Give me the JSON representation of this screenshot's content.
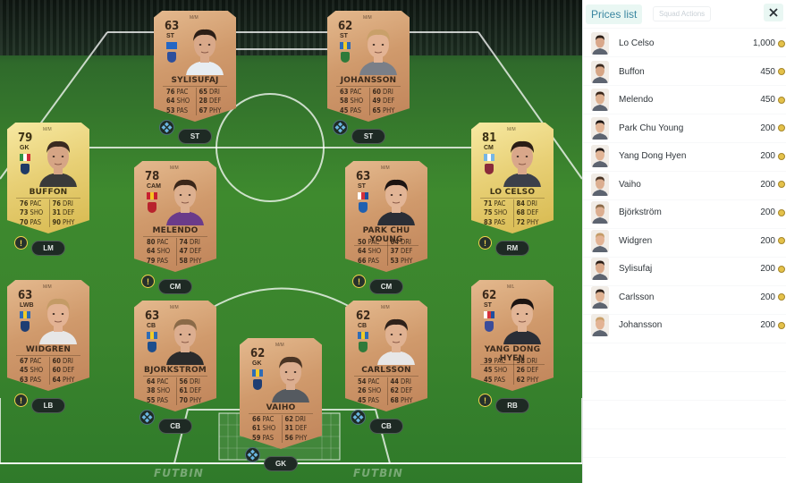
{
  "pitch": {
    "watermarks": [
      "FUTBIN",
      "FUTBIN"
    ],
    "cards": [
      {
        "id": "sylisufaj",
        "tier": "bronze",
        "rating": "63",
        "position": "ST",
        "chem": "M/M",
        "name": "SYLISUFAJ",
        "flag": [
          "#2466c4",
          "#2466c4",
          "#2466c4"
        ],
        "club": "#2d4f9c",
        "skin": "#d9a98a",
        "hair": "#2b1e16",
        "shirt": "#e7edf2",
        "stats": [
          [
            "76",
            "PAC"
          ],
          [
            "64",
            "SHO"
          ],
          [
            "53",
            "PAS"
          ],
          [
            "65",
            "DRI"
          ],
          [
            "28",
            "DEF"
          ],
          [
            "67",
            "PHY"
          ]
        ],
        "badge": "ST",
        "badge_type": "chem"
      },
      {
        "id": "johansson",
        "tier": "bronze",
        "rating": "62",
        "position": "ST",
        "chem": "M/M",
        "name": "JOHANSSON",
        "flag": [
          "#2f6cb6",
          "#f1cc29",
          "#2f6cb6"
        ],
        "club": "#2f7a3a",
        "skin": "#e3b394",
        "hair": "#c9a06a",
        "shirt": "#7a7f88",
        "stats": [
          [
            "63",
            "PAC"
          ],
          [
            "58",
            "SHO"
          ],
          [
            "45",
            "PAS"
          ],
          [
            "60",
            "DRI"
          ],
          [
            "49",
            "DEF"
          ],
          [
            "65",
            "PHY"
          ]
        ],
        "badge": "ST",
        "badge_type": "chem"
      },
      {
        "id": "buffon",
        "tier": "gold",
        "rating": "79",
        "position": "GK",
        "chem": "M/M",
        "name": "BUFFON",
        "flag": [
          "#2f9345",
          "#ffffff",
          "#cf2b37"
        ],
        "club": "#1f3a66",
        "skin": "#d6a585",
        "hair": "#3a2a20",
        "shirt": "#3a3a3a",
        "stats": [
          [
            "76",
            "PAC"
          ],
          [
            "73",
            "SHO"
          ],
          [
            "70",
            "PAS"
          ],
          [
            "76",
            "DRI"
          ],
          [
            "31",
            "DEF"
          ],
          [
            "90",
            "PHY"
          ]
        ],
        "badge": "LM",
        "badge_type": "alert"
      },
      {
        "id": "melendo",
        "tier": "bronze",
        "rating": "78",
        "position": "CAM",
        "chem": "M/M",
        "name": "MELENDO",
        "flag": [
          "#c8202f",
          "#f6c324",
          "#c8202f"
        ],
        "club": "#b8232d",
        "skin": "#ddb090",
        "hair": "#3a2619",
        "shirt": "#6a3b8a",
        "stats": [
          [
            "80",
            "PAC"
          ],
          [
            "64",
            "SHO"
          ],
          [
            "79",
            "PAS"
          ],
          [
            "74",
            "DRI"
          ],
          [
            "47",
            "DEF"
          ],
          [
            "58",
            "PHY"
          ]
        ],
        "badge": "CM",
        "badge_type": "alert"
      },
      {
        "id": "parkchuyoung",
        "tier": "bronze",
        "rating": "63",
        "position": "ST",
        "chem": "M/M",
        "name": "PARK CHU YOUNG",
        "flag": [
          "#ffffff",
          "#d6313b",
          "#1d4fa0"
        ],
        "club": "#1f60b0",
        "skin": "#e2b596",
        "hair": "#1c1412",
        "shirt": "#2a2e36",
        "stats": [
          [
            "50",
            "PAC"
          ],
          [
            "64",
            "SHO"
          ],
          [
            "66",
            "PAS"
          ],
          [
            "64",
            "DRI"
          ],
          [
            "37",
            "DEF"
          ],
          [
            "53",
            "PHY"
          ]
        ],
        "badge": "CM",
        "badge_type": "alert"
      },
      {
        "id": "locelso",
        "tier": "gold",
        "rating": "81",
        "position": "CM",
        "chem": "M/M",
        "name": "LO CELSO",
        "flag": [
          "#76b6e4",
          "#ffffff",
          "#76b6e4"
        ],
        "club": "#8a2a3a",
        "skin": "#d9a78a",
        "hair": "#2a1d15",
        "shirt": "#3b3f4a",
        "stats": [
          [
            "71",
            "PAC"
          ],
          [
            "75",
            "SHO"
          ],
          [
            "83",
            "PAS"
          ],
          [
            "84",
            "DRI"
          ],
          [
            "68",
            "DEF"
          ],
          [
            "72",
            "PHY"
          ]
        ],
        "badge": "RM",
        "badge_type": "alert"
      },
      {
        "id": "widgren",
        "tier": "bronze",
        "rating": "63",
        "position": "LWB",
        "chem": "M/M",
        "name": "WIDGREN",
        "flag": [
          "#2f6cb6",
          "#f1cc29",
          "#2f6cb6"
        ],
        "club": "#1f3e73",
        "skin": "#e3b394",
        "hair": "#c49b66",
        "shirt": "#e7e7e7",
        "stats": [
          [
            "67",
            "PAC"
          ],
          [
            "45",
            "SHO"
          ],
          [
            "63",
            "PAS"
          ],
          [
            "60",
            "DRI"
          ],
          [
            "60",
            "DEF"
          ],
          [
            "64",
            "PHY"
          ]
        ],
        "badge": "LB",
        "badge_type": "alert"
      },
      {
        "id": "bjorkstrom",
        "tier": "bronze",
        "rating": "63",
        "position": "CB",
        "chem": "M/M",
        "name": "BJORKSTROM",
        "flag": [
          "#2f6cb6",
          "#f1cc29",
          "#2f6cb6"
        ],
        "club": "#1c4d8c",
        "skin": "#dcae90",
        "hair": "#8a6a48",
        "shirt": "#2b2b2b",
        "stats": [
          [
            "64",
            "PAC"
          ],
          [
            "38",
            "SHO"
          ],
          [
            "55",
            "PAS"
          ],
          [
            "56",
            "DRI"
          ],
          [
            "61",
            "DEF"
          ],
          [
            "70",
            "PHY"
          ]
        ],
        "badge": "CB",
        "badge_type": "chem"
      },
      {
        "id": "vaiho",
        "tier": "bronze",
        "rating": "62",
        "position": "GK",
        "chem": "M/M",
        "name": "VAIHO",
        "flag": [
          "#2f6cb6",
          "#f1cc29",
          "#2f6cb6"
        ],
        "club": "#1f3e73",
        "skin": "#dcae90",
        "hair": "#4a3424",
        "shirt": "#555a60",
        "stats": [
          [
            "66",
            "PAC"
          ],
          [
            "61",
            "SHO"
          ],
          [
            "59",
            "PAS"
          ],
          [
            "62",
            "DRI"
          ],
          [
            "31",
            "DEF"
          ],
          [
            "56",
            "PHY"
          ]
        ],
        "badge": "GK",
        "badge_type": "chem"
      },
      {
        "id": "carlsson",
        "tier": "bronze",
        "rating": "62",
        "position": "CB",
        "chem": "M/M",
        "name": "CARLSSON",
        "flag": [
          "#2f6cb6",
          "#f1cc29",
          "#2f6cb6"
        ],
        "club": "#2f7a3a",
        "skin": "#e0b292",
        "hair": "#2e211a",
        "shirt": "#e7e7e7",
        "stats": [
          [
            "54",
            "PAC"
          ],
          [
            "26",
            "SHO"
          ],
          [
            "45",
            "PAS"
          ],
          [
            "44",
            "DRI"
          ],
          [
            "62",
            "DEF"
          ],
          [
            "68",
            "PHY"
          ]
        ],
        "badge": "CB",
        "badge_type": "chem"
      },
      {
        "id": "yangdonghyen",
        "tier": "bronze",
        "rating": "62",
        "position": "ST",
        "chem": "M/L",
        "name": "YANG DONG HYEN",
        "flag": [
          "#ffffff",
          "#d6313b",
          "#1d4fa0"
        ],
        "club": "#3a4c9a",
        "skin": "#e2b596",
        "hair": "#1c1412",
        "shirt": "#2a2e36",
        "stats": [
          [
            "39",
            "PAC"
          ],
          [
            "45",
            "SHO"
          ],
          [
            "45",
            "PAS"
          ],
          [
            "58",
            "DRI"
          ],
          [
            "26",
            "DEF"
          ],
          [
            "62",
            "PHY"
          ]
        ],
        "badge": "RB",
        "badge_type": "alert"
      }
    ]
  },
  "panel": {
    "title": "Prices list",
    "ghost_tab": "Squad Actions",
    "close_label": "close",
    "items": [
      {
        "name": "Lo Celso",
        "price": "1,000",
        "skin": "#d9a78a",
        "hair": "#2a1d15"
      },
      {
        "name": "Buffon",
        "price": "450",
        "skin": "#d6a585",
        "hair": "#3a2a20"
      },
      {
        "name": "Melendo",
        "price": "450",
        "skin": "#ddb090",
        "hair": "#3a2619"
      },
      {
        "name": "Park Chu Young",
        "price": "200",
        "skin": "#e2b596",
        "hair": "#1c1412"
      },
      {
        "name": "Yang Dong Hyen",
        "price": "200",
        "skin": "#e2b596",
        "hair": "#1c1412"
      },
      {
        "name": "Vaiho",
        "price": "200",
        "skin": "#dcae90",
        "hair": "#4a3424"
      },
      {
        "name": "Björkström",
        "price": "200",
        "skin": "#dcae90",
        "hair": "#8a6a48"
      },
      {
        "name": "Widgren",
        "price": "200",
        "skin": "#e3b394",
        "hair": "#c49b66"
      },
      {
        "name": "Sylisufaj",
        "price": "200",
        "skin": "#d9a98a",
        "hair": "#2b1e16"
      },
      {
        "name": "Carlsson",
        "price": "200",
        "skin": "#e0b292",
        "hair": "#2e211a"
      },
      {
        "name": "Johansson",
        "price": "200",
        "skin": "#e3b394",
        "hair": "#c9a06a"
      }
    ]
  }
}
